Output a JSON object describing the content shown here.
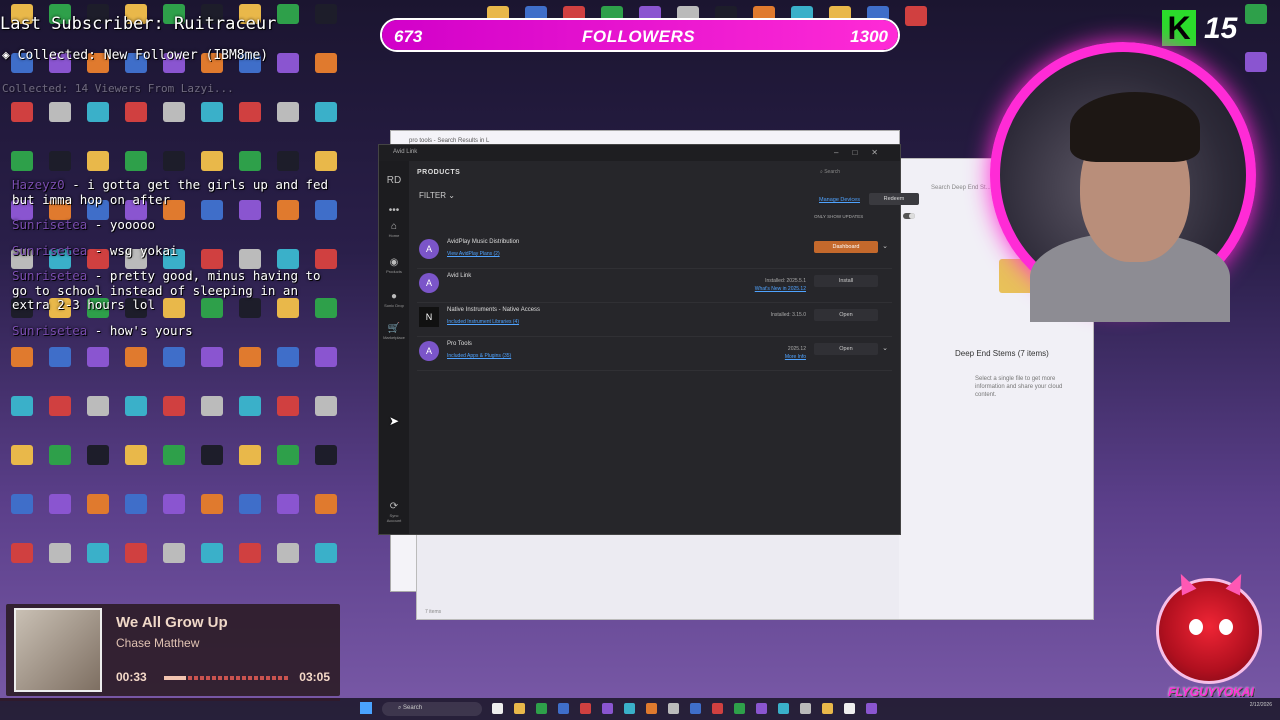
{
  "overlay": {
    "subscriber": "Last Subscriber: Ruitraceur",
    "collected": "Collected: New Follower (IBM8me)",
    "collected_faded": "Collected: 14 Viewers From Lazyi..."
  },
  "chat": [
    {
      "user": "Hazeyz0",
      "message": " - i gotta get the girls up and fed but imma hop on after"
    },
    {
      "user": "Sunrisetea",
      "message": " - yooooo"
    },
    {
      "user": "Sunrisetea",
      "message": " - wsg yokai"
    },
    {
      "user": "Sunrisetea",
      "message": " - pretty good, minus having to go to school instead of sleeping in an extra 2-3 hours lol"
    },
    {
      "user": "Sunrisetea",
      "message": " - how's yours"
    }
  ],
  "followers_goal": {
    "current": "673",
    "label": "FOLLOWERS",
    "target": "1300",
    "progress": 1.0
  },
  "k_counter": {
    "letter": "K",
    "value": "15"
  },
  "browser": {
    "tab_title": "pro tools - Search Results in L"
  },
  "explorer": {
    "search_placeholder": "Search Deep End St...",
    "folder_title": "Deep End Stems (7 items)",
    "hint": "Select a single file to get more information and share your cloud content.",
    "items_count": "7 items"
  },
  "avid": {
    "window_title": "Avid Link",
    "rail": [
      {
        "label": "RD",
        "icon": "avatar-icon"
      },
      {
        "label": "",
        "icon": "more-icon"
      },
      {
        "label": "Home",
        "icon": "home-icon"
      },
      {
        "label": "Products",
        "icon": "products-icon"
      },
      {
        "label": "Sonic Drop",
        "icon": "sonic-drop-icon"
      },
      {
        "label": "Marketplace",
        "icon": "cart-icon"
      },
      {
        "label": "Sync Account",
        "icon": "sync-icon"
      }
    ],
    "products_title": "PRODUCTS",
    "search_placeholder": "Search",
    "filter_label": "FILTER",
    "manage_devices": "Manage Devices",
    "redeem": "Redeem",
    "only_show_updates": "ONLY SHOW UPDATES",
    "products": [
      {
        "name": "AvidPlay Music Distribution",
        "link": "View AvidPlay Plans (2)",
        "status_line1": "",
        "status_link": "",
        "button": "Dashboard",
        "button_style": "orange",
        "has_chevron": true,
        "logo": "A"
      },
      {
        "name": "Avid Link",
        "link": "",
        "status_line1": "Installed: 2025.5.1",
        "status_link": "What's New in 2025.12",
        "button": "Install",
        "button_style": "gray",
        "has_chevron": false,
        "logo": "A"
      },
      {
        "name": "Native Instruments - Native Access",
        "link": "Included Instrument Libraries (4)",
        "status_line1": "Installed: 3.15.0",
        "status_link": "",
        "button": "Open",
        "button_style": "gray",
        "has_chevron": false,
        "logo": "N"
      },
      {
        "name": "Pro Tools",
        "link": "Included Apps & Plugins (35)",
        "status_line1": "2025.12",
        "status_link": "More Info",
        "button": "Open",
        "button_style": "gray",
        "has_chevron": true,
        "logo": "A"
      }
    ]
  },
  "now_playing": {
    "title": "We All Grow Up",
    "artist": "Chase Matthew",
    "elapsed": "00:33",
    "duration": "03:05",
    "progress": 0.18
  },
  "mascot": {
    "name": "FLYGUYYOKAI"
  },
  "taskbar": {
    "search_placeholder": "Search",
    "date": "2/12/2026"
  },
  "colors": {
    "accent": "#ff2bd6",
    "avid_orange": "#c4692c",
    "link_blue": "#4fa3ff"
  }
}
